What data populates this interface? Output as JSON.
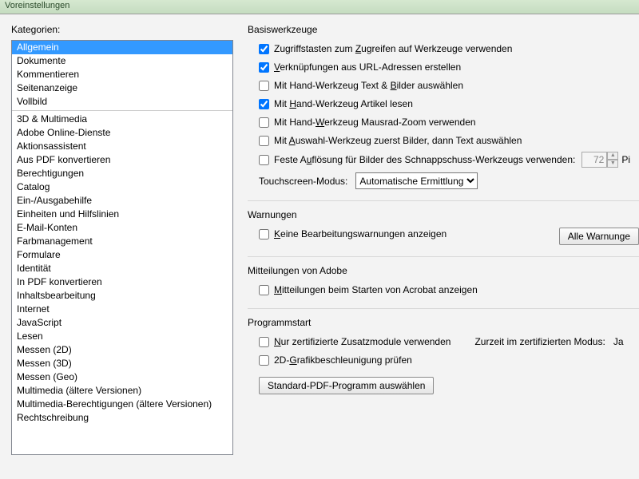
{
  "window": {
    "title": "Voreinstellungen"
  },
  "sidebar": {
    "label": "Kategorien:",
    "groups": [
      [
        "Allgemein",
        "Dokumente",
        "Kommentieren",
        "Seitenanzeige",
        "Vollbild"
      ],
      [
        "3D & Multimedia",
        "Adobe Online-Dienste",
        "Aktionsassistent",
        "Aus PDF konvertieren",
        "Berechtigungen",
        "Catalog",
        "Ein-/Ausgabehilfe",
        "Einheiten und Hilfslinien",
        "E-Mail-Konten",
        "Farbmanagement",
        "Formulare",
        "Identität",
        "In PDF konvertieren",
        "Inhaltsbearbeitung",
        "Internet",
        "JavaScript",
        "Lesen",
        "Messen (2D)",
        "Messen (3D)",
        "Messen (Geo)",
        "Multimedia (ältere Versionen)",
        "Multimedia-Berechtigungen (ältere Versionen)",
        "Rechtschreibung"
      ]
    ],
    "selected": "Allgemein"
  },
  "basic": {
    "title": "Basiswerkzeuge",
    "opts": [
      {
        "pre": "Zugriffstasten zum ",
        "key": "Z",
        "post": "ugreifen auf Werkzeuge verwenden",
        "checked": true
      },
      {
        "pre": "",
        "key": "V",
        "post": "erknüpfungen aus URL-Adressen erstellen",
        "checked": true
      },
      {
        "pre": "Mit Hand-Werkzeug Text & ",
        "key": "B",
        "post": "ilder auswählen",
        "checked": false
      },
      {
        "pre": "Mit ",
        "key": "H",
        "post": "and-Werkzeug Artikel lesen",
        "checked": true
      },
      {
        "pre": "Mit Hand-",
        "key": "W",
        "post": "erkzeug Mausrad-Zoom verwenden",
        "checked": false
      },
      {
        "pre": "Mit ",
        "key": "A",
        "post": "uswahl-Werkzeug zuerst Bilder, dann Text auswählen",
        "checked": false
      }
    ],
    "res": {
      "pre": "Feste A",
      "key": "u",
      "post": "flösung für Bilder des Schnappschuss-Werkzeugs verwenden:",
      "checked": false,
      "value": "72",
      "unit": "Pi"
    },
    "touch": {
      "label": "Touchscreen-Modus:",
      "value": "Automatische Ermittlung"
    }
  },
  "warn": {
    "title": "Warnungen",
    "opt": {
      "pre": "",
      "key": "K",
      "post": "eine Bearbeitungswarnungen anzeigen",
      "checked": false
    },
    "button": "Alle Warnunge"
  },
  "adobe": {
    "title": "Mitteilungen von Adobe",
    "opt": {
      "pre": "",
      "key": "M",
      "post": "itteilungen beim Starten von Acrobat anzeigen",
      "checked": false
    }
  },
  "startup": {
    "title": "Programmstart",
    "opt1": {
      "pre": "",
      "key": "N",
      "post": "ur zertifizierte Zusatzmodule verwenden",
      "checked": false
    },
    "mode_label": "Zurzeit im zertifizierten Modus:",
    "mode_value": "Ja",
    "opt2": {
      "pre": "2D-",
      "key": "G",
      "post": "rafikbeschleunigung prüfen",
      "checked": false
    },
    "button": "Standard-PDF-Programm auswählen"
  }
}
